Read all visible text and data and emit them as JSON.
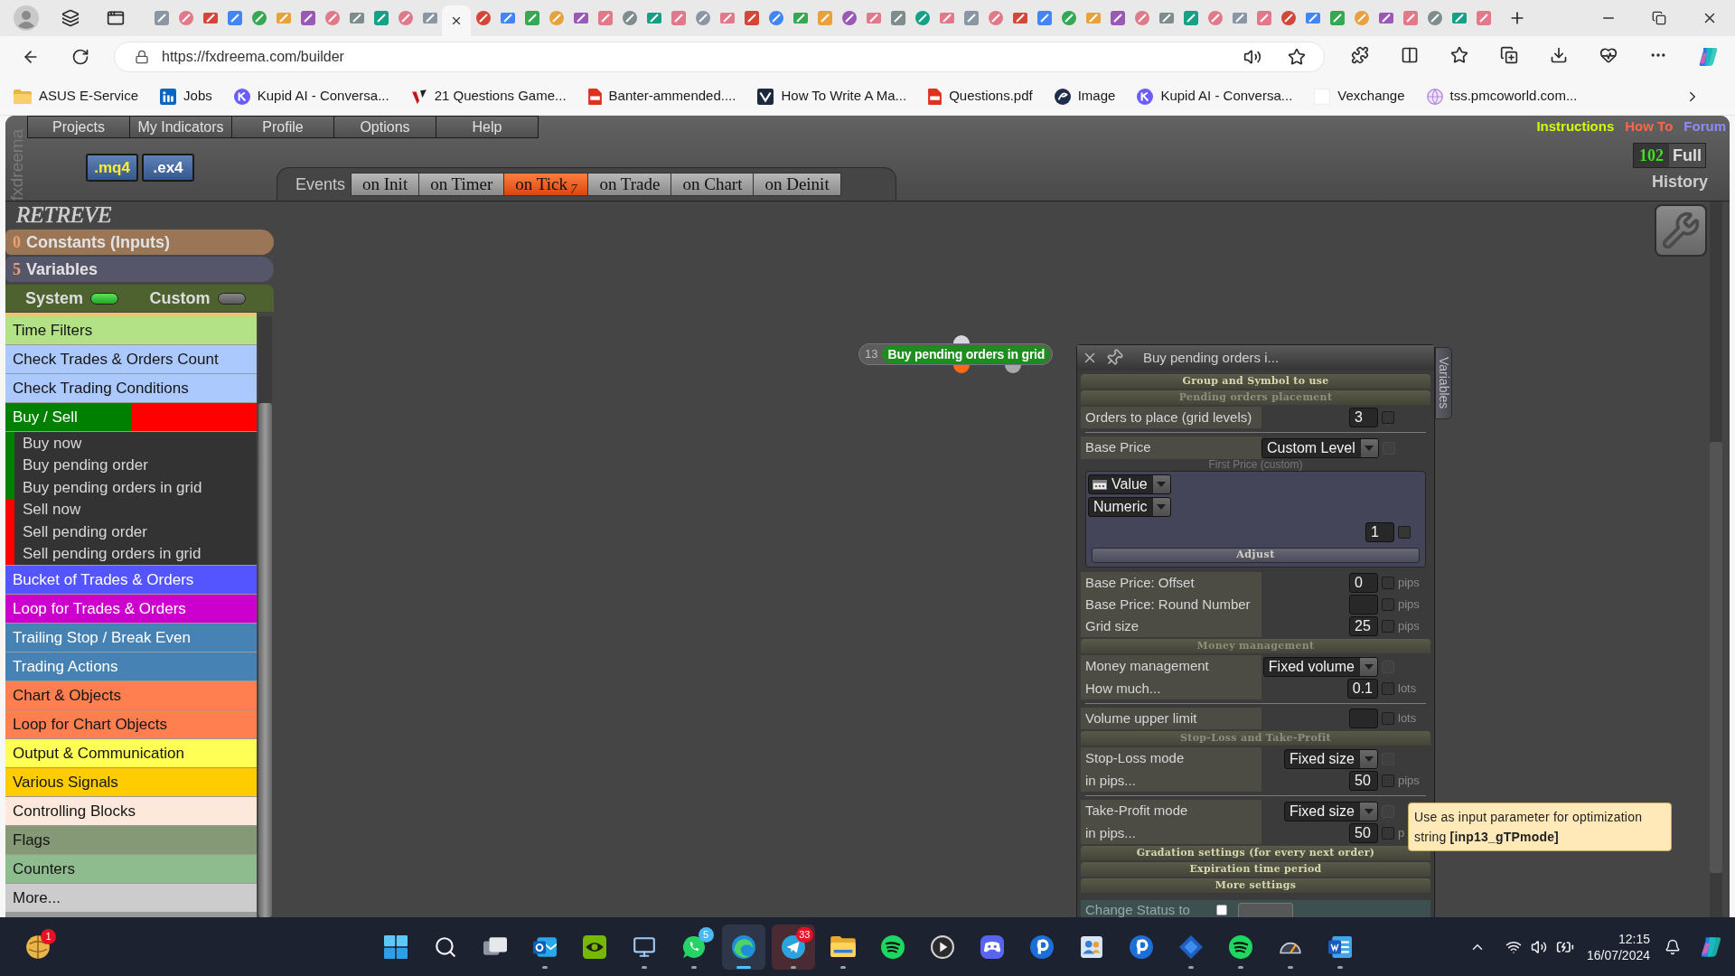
{
  "browser": {
    "tabs": [
      {
        "selected": false
      },
      {
        "selected": false
      },
      {
        "selected": false
      },
      {
        "selected": false
      },
      {
        "selected": false
      },
      {
        "selected": false
      },
      {
        "selected": false
      },
      {
        "selected": false
      },
      {
        "selected": false
      },
      {
        "selected": false
      },
      {
        "selected": false
      },
      {
        "selected": false
      },
      {
        "selected": true
      },
      {
        "selected": false
      },
      {
        "selected": false
      },
      {
        "selected": false
      },
      {
        "selected": false
      },
      {
        "selected": false
      },
      {
        "selected": false
      },
      {
        "selected": false
      },
      {
        "selected": false
      },
      {
        "selected": false
      },
      {
        "selected": false
      },
      {
        "selected": false
      },
      {
        "selected": false
      },
      {
        "selected": false
      },
      {
        "selected": false
      },
      {
        "selected": false
      },
      {
        "selected": false
      },
      {
        "selected": false
      },
      {
        "selected": false
      },
      {
        "selected": false
      },
      {
        "selected": false
      },
      {
        "selected": false
      },
      {
        "selected": false
      },
      {
        "selected": false
      },
      {
        "selected": false
      },
      {
        "selected": false
      },
      {
        "selected": false
      },
      {
        "selected": false
      },
      {
        "selected": false
      },
      {
        "selected": false
      },
      {
        "selected": false
      },
      {
        "selected": false
      },
      {
        "selected": false
      },
      {
        "selected": false
      },
      {
        "selected": false
      },
      {
        "selected": false
      },
      {
        "selected": false
      },
      {
        "selected": false
      },
      {
        "selected": false
      },
      {
        "selected": false
      },
      {
        "selected": false
      },
      {
        "selected": false
      },
      {
        "selected": false
      }
    ],
    "url": "https://fxdreema.com/builder",
    "bookmarks": [
      {
        "label": "ASUS E-Service",
        "kind": "folder"
      },
      {
        "label": "Jobs",
        "kind": "in"
      },
      {
        "label": "Kupid AI - Conversa...",
        "kind": "k"
      },
      {
        "label": "21 Questions Game...",
        "kind": "v"
      },
      {
        "label": "Banter-ammended....",
        "kind": "pdf"
      },
      {
        "label": "How To Write A Ma...",
        "kind": "vbox"
      },
      {
        "label": "Questions.pdf",
        "kind": "pdf"
      },
      {
        "label": "Image",
        "kind": "swirl"
      },
      {
        "label": "Kupid AI - Conversa...",
        "kind": "k"
      },
      {
        "label": "Vexchange",
        "kind": "blank"
      },
      {
        "label": "tss.pmcoworld.com...",
        "kind": "globe"
      }
    ]
  },
  "app": {
    "brand": "fxdreema",
    "menu": [
      "Projects",
      "My Indicators",
      "Profile",
      "Options",
      "Help"
    ],
    "file_buttons": [
      {
        "label": ".mq4",
        "selected": true
      },
      {
        "label": ".ex4",
        "selected": false
      }
    ],
    "links": [
      {
        "label": "Instructions",
        "color": "#ccff00"
      },
      {
        "label": "How To",
        "color": "#ff6644"
      },
      {
        "label": "Forum",
        "color": "#8c8cff"
      }
    ],
    "counter": "102",
    "mode": "Full",
    "history": "History",
    "events": {
      "label": "Events",
      "tabs": [
        {
          "label": "on Init",
          "selected": false
        },
        {
          "label": "on Timer",
          "selected": false
        },
        {
          "label": "on Tick",
          "count": "7",
          "selected": true
        },
        {
          "label": "on Trade",
          "selected": false
        },
        {
          "label": "on Chart",
          "selected": false
        },
        {
          "label": "on Deinit",
          "selected": false
        }
      ]
    },
    "sidebar": {
      "title": "RETREVE",
      "sections": [
        {
          "count": "0",
          "label": "Constants (Inputs)",
          "color": "#9a7657"
        },
        {
          "count": "5",
          "label": "Variables",
          "color": "#56566b"
        }
      ],
      "toggles": [
        {
          "label": "System",
          "on": true
        },
        {
          "label": "Custom",
          "on": false
        }
      ],
      "categories": [
        {
          "label": "Time Filters",
          "color": "#b2e285"
        },
        {
          "label": "Check Trades & Orders Count",
          "color": "#abc9fc"
        },
        {
          "label": "Check Trading Conditions",
          "color": "#abc9fc"
        },
        {
          "label": "Buy / Sell",
          "color": "#008000",
          "accent": {
            "color": "#ff0000"
          },
          "children": [
            {
              "label": "Buy now",
              "color": "#008000"
            },
            {
              "label": "Buy pending order",
              "color": "#008000"
            },
            {
              "label": "Buy pending orders in grid",
              "color": "#008000"
            },
            {
              "label": "Sell now",
              "color": "#ff0000"
            },
            {
              "label": "Sell pending order",
              "color": "#ff0000"
            },
            {
              "label": "Sell pending orders in grid",
              "color": "#ff0000"
            }
          ]
        },
        {
          "label": "Bucket of Trades & Orders",
          "color": "#5555ff"
        },
        {
          "label": "Loop for Trades & Orders",
          "color": "#cc00cc"
        },
        {
          "label": "Trailing Stop / Break Even",
          "color": "#4682b4"
        },
        {
          "label": "Trading Actions",
          "color": "#4682b4"
        },
        {
          "label": "Chart & Objects",
          "color": "#ff7f50"
        },
        {
          "label": "Loop for Chart Objects",
          "color": "#ff7f50"
        },
        {
          "label": "Output & Communication",
          "color": "#ffff55"
        },
        {
          "label": "Various Signals",
          "color": "#ffcc00"
        },
        {
          "label": "Controlling Blocks",
          "color": "#fde9dc"
        },
        {
          "label": "Flags",
          "color": "#869977"
        },
        {
          "label": "Counters",
          "color": "#8fbc8f"
        },
        {
          "label": "More...",
          "color": "#cccccc"
        }
      ]
    },
    "node": {
      "number": "13",
      "label": "Buy pending orders in grid"
    },
    "panel": {
      "title": "Buy pending orders i...",
      "side_tab": "Variables",
      "sections": [
        {
          "title": "Group and Symbol to use",
          "expanded": false
        },
        {
          "title": "Pending orders placement",
          "expanded": true,
          "blocks": [
            {
              "rows": [
                {
                  "kind": "number",
                  "label": "Orders to place (grid levels)",
                  "value": "3",
                  "checked": false
                }
              ]
            },
            {
              "rows": [
                {
                  "kind": "select",
                  "label": "Base Price",
                  "value": "Custom Level",
                  "checked": false
                },
                {
                  "kind": "caption",
                  "label": "First Price (custom)"
                },
                {
                  "kind": "group",
                  "selects": [
                    {
                      "label": "Value",
                      "kind": "typed"
                    },
                    {
                      "label": "Numeric",
                      "kind": "plain"
                    }
                  ],
                  "value": "1",
                  "checked": false,
                  "button": "Adjust"
                }
              ]
            },
            {
              "rows": [
                {
                  "kind": "number",
                  "label": "Base Price: Offset",
                  "value": "0",
                  "unit": "pips",
                  "checked": false
                },
                {
                  "kind": "number",
                  "label": "Base Price: Round Number",
                  "unit": "pips",
                  "checked": false
                },
                {
                  "kind": "number",
                  "label": "Grid size",
                  "value": "25",
                  "unit": "pips",
                  "checked": false
                }
              ]
            }
          ]
        },
        {
          "title": "Money management",
          "expanded": true,
          "blocks": [
            {
              "rows": [
                {
                  "kind": "select",
                  "label": "Money management",
                  "value": "Fixed volume",
                  "checked": false
                },
                {
                  "kind": "number",
                  "label": "How much...",
                  "value": "0.1",
                  "unit": "lots",
                  "checked": false
                }
              ]
            },
            {
              "rows": [
                {
                  "kind": "number",
                  "label": "Volume upper limit",
                  "unit": "lots",
                  "checked": false
                }
              ]
            }
          ]
        },
        {
          "title": "Stop-Loss and Take-Profit",
          "expanded": true,
          "blocks": [
            {
              "rows": [
                {
                  "kind": "select",
                  "label": "Stop-Loss mode",
                  "value": "Fixed size",
                  "checked": false
                },
                {
                  "kind": "number",
                  "label": "in pips...",
                  "value": "50",
                  "unit": "pips",
                  "checked": false
                }
              ]
            },
            {
              "rows": [
                {
                  "kind": "select",
                  "label": "Take-Profit mode",
                  "value": "Fixed size",
                  "checked": false
                },
                {
                  "kind": "number",
                  "label": "in pips...",
                  "value": "50",
                  "unit": "p",
                  "checked": false
                }
              ]
            }
          ]
        },
        {
          "title": "Gradation settings (for every next order)",
          "expanded": false
        },
        {
          "title": "Expiration time period",
          "expanded": false
        },
        {
          "title": "More settings",
          "expanded": false
        }
      ],
      "status": {
        "label": "Change Status to",
        "checked": false
      }
    },
    "tooltip": "Use as input parameter for optimization string **[inp13_gTPmode]**"
  },
  "taskbar": {
    "widget": {
      "badge": {
        "label": "1",
        "color": "#e81123"
      }
    },
    "apps": [
      {
        "kind": "start",
        "running": false,
        "selected": false,
        "attention": false
      },
      {
        "kind": "search",
        "running": false,
        "selected": false,
        "attention": false
      },
      {
        "kind": "taskview",
        "running": false,
        "selected": false,
        "attention": false
      },
      {
        "kind": "mail",
        "running": true,
        "selected": false,
        "attention": false
      },
      {
        "kind": "eye",
        "running": false,
        "selected": false,
        "attention": false
      },
      {
        "kind": "monitor",
        "running": true,
        "selected": false,
        "attention": false
      },
      {
        "kind": "chat",
        "badge": {
          "label": "5",
          "color": "#4cb8f0"
        },
        "running": true,
        "selected": false,
        "attention": false
      },
      {
        "kind": "browser",
        "running": true,
        "selected": true,
        "attention": false
      },
      {
        "kind": "send",
        "badge": {
          "label": "33",
          "color": "#e81123"
        },
        "running": true,
        "selected": false,
        "attention": true
      },
      {
        "kind": "folder",
        "running": true,
        "selected": false,
        "attention": false
      },
      {
        "kind": "music",
        "running": false,
        "selected": false,
        "attention": false
      },
      {
        "kind": "play",
        "running": false,
        "selected": false,
        "attention": false
      },
      {
        "kind": "controller",
        "running": false,
        "selected": false,
        "attention": false
      },
      {
        "kind": "p",
        "running": false,
        "selected": false,
        "attention": false
      },
      {
        "kind": "contacts",
        "running": false,
        "selected": false,
        "attention": false
      },
      {
        "kind": "p",
        "running": false,
        "selected": false,
        "attention": false
      },
      {
        "kind": "diamond",
        "running": true,
        "selected": false,
        "attention": false
      },
      {
        "kind": "music",
        "running": true,
        "selected": false,
        "attention": false
      },
      {
        "kind": "gauge",
        "running": true,
        "selected": false,
        "attention": false
      },
      {
        "kind": "word",
        "running": true,
        "selected": false,
        "attention": false
      }
    ],
    "time": "12:15",
    "date": "16/07/2024"
  }
}
